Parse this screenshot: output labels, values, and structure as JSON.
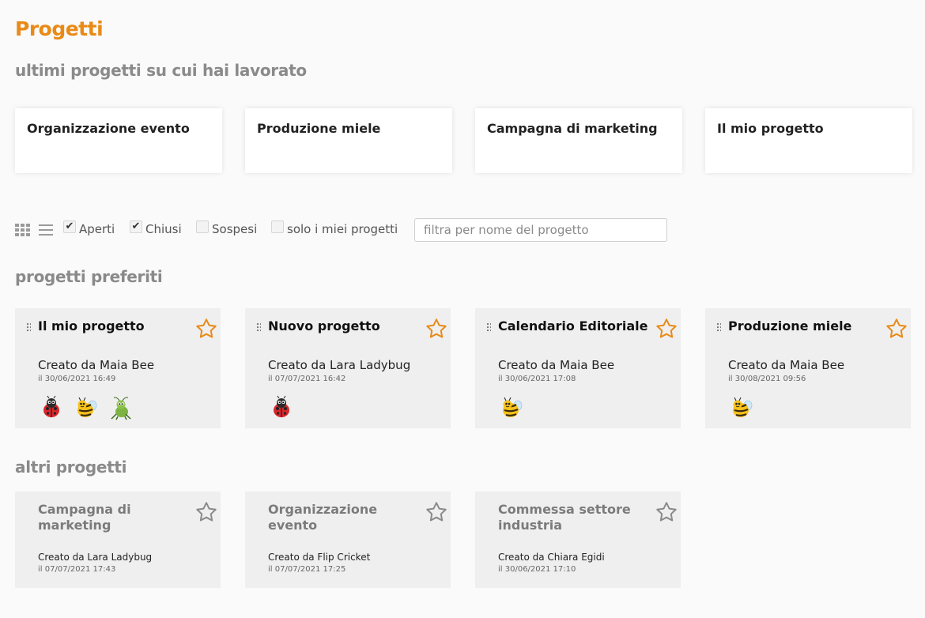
{
  "page": {
    "title": "Progetti"
  },
  "recent": {
    "heading": "ultimi progetti su cui hai lavorato",
    "items": [
      "Organizzazione evento",
      "Produzione miele",
      "Campagna di marketing",
      "Il mio progetto"
    ]
  },
  "toolbar": {
    "grid_view_icon": "grid-icon",
    "list_view_icon": "list-icon",
    "filters": [
      {
        "label": "Aperti",
        "checked": true
      },
      {
        "label": "Chiusi",
        "checked": true
      },
      {
        "label": "Sospesi",
        "checked": false
      },
      {
        "label": "solo i miei progetti",
        "checked": false
      }
    ],
    "search_placeholder": "filtra per nome del progetto"
  },
  "favorites": {
    "heading": "progetti preferiti",
    "items": [
      {
        "title": "Il mio progetto",
        "creator": "Creato da Maia Bee",
        "date": "il 30/06/2021 16:49",
        "avatars": [
          "ladybug",
          "bee",
          "cricket"
        ]
      },
      {
        "title": "Nuovo progetto",
        "creator": "Creato da Lara Ladybug",
        "date": "il 07/07/2021 16:42",
        "avatars": [
          "ladybug"
        ]
      },
      {
        "title": "Calendario Editoriale",
        "creator": "Creato da Maia Bee",
        "date": "il 30/06/2021 17:08",
        "avatars": [
          "bee"
        ]
      },
      {
        "title": "Produzione miele",
        "creator": "Creato da Maia Bee",
        "date": "il 30/08/2021 09:56",
        "avatars": [
          "bee"
        ]
      }
    ]
  },
  "others": {
    "heading": "altri progetti",
    "items": [
      {
        "title": "Campagna di marketing",
        "creator": "Creato da Lara Ladybug",
        "date": "il 07/07/2021 17:43"
      },
      {
        "title": "Organizzazione evento",
        "creator": "Creato da Flip Cricket",
        "date": "il 07/07/2021 17:25"
      },
      {
        "title": "Commessa settore industria",
        "creator": "Creato da Chiara Egidi",
        "date": "il 30/06/2021 17:10"
      }
    ]
  },
  "colors": {
    "accent": "#e98a16",
    "star_off": "#8a8a8a"
  }
}
